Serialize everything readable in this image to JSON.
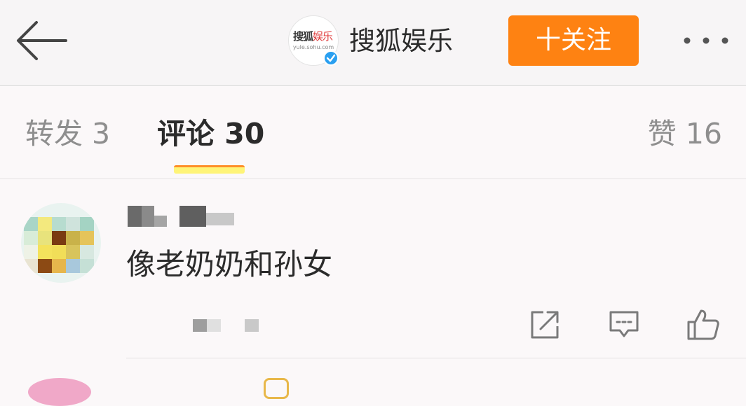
{
  "header": {
    "back_icon": "arrow-left-icon",
    "account_name": "搜狐娱乐",
    "logo": {
      "main_dark": "搜狐",
      "main_red": "娱乐",
      "sub": "yule.sohu.com"
    },
    "verified_icon": "check-icon",
    "follow_label": "十关注",
    "more_icon": "more-dots-icon",
    "accent_color": "#fe8212"
  },
  "tabs": {
    "repost": "转发 3",
    "comments": "评论 30",
    "likes": "赞 16",
    "active": "comments"
  },
  "comment": {
    "text": "像老奶奶和孙女",
    "actions": {
      "share_icon": "share-icon",
      "reply_icon": "comment-icon",
      "like_icon": "thumbs-up-icon"
    }
  }
}
